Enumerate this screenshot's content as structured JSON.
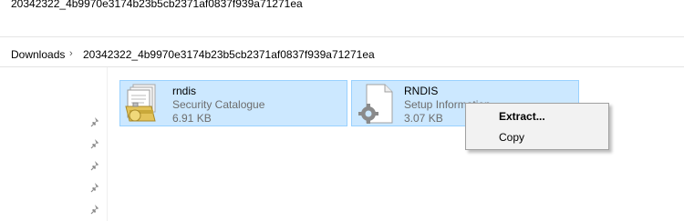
{
  "window": {
    "title": "20342322_4b9970e3174b23b5cb2371af0837f939a71271ea"
  },
  "address_bar": {
    "crumbs": [
      "Downloads",
      "20342322_4b9970e3174b23b5cb2371af0837f939a71271ea"
    ]
  },
  "nav_pane": {
    "pins": [
      "pin-icon",
      "pin-icon",
      "pin-icon",
      "pin-icon",
      "pin-icon"
    ]
  },
  "files": [
    {
      "name": "rndis",
      "type": "Security Catalogue",
      "size": "6.91 KB",
      "icon": "security-catalogue-icon",
      "selected": true
    },
    {
      "name": "RNDIS",
      "type": "Setup Information",
      "size": "3.07 KB",
      "icon": "setup-information-icon",
      "selected": true
    }
  ],
  "context_menu": {
    "items": [
      {
        "label": "Extract...",
        "default": true
      },
      {
        "label": "Copy",
        "default": false
      }
    ]
  },
  "colors": {
    "selection_bg": "#cce8ff",
    "selection_border": "#99d1ff",
    "menu_bg": "#f2f2f2",
    "secondary_text": "#6d6d6d"
  }
}
